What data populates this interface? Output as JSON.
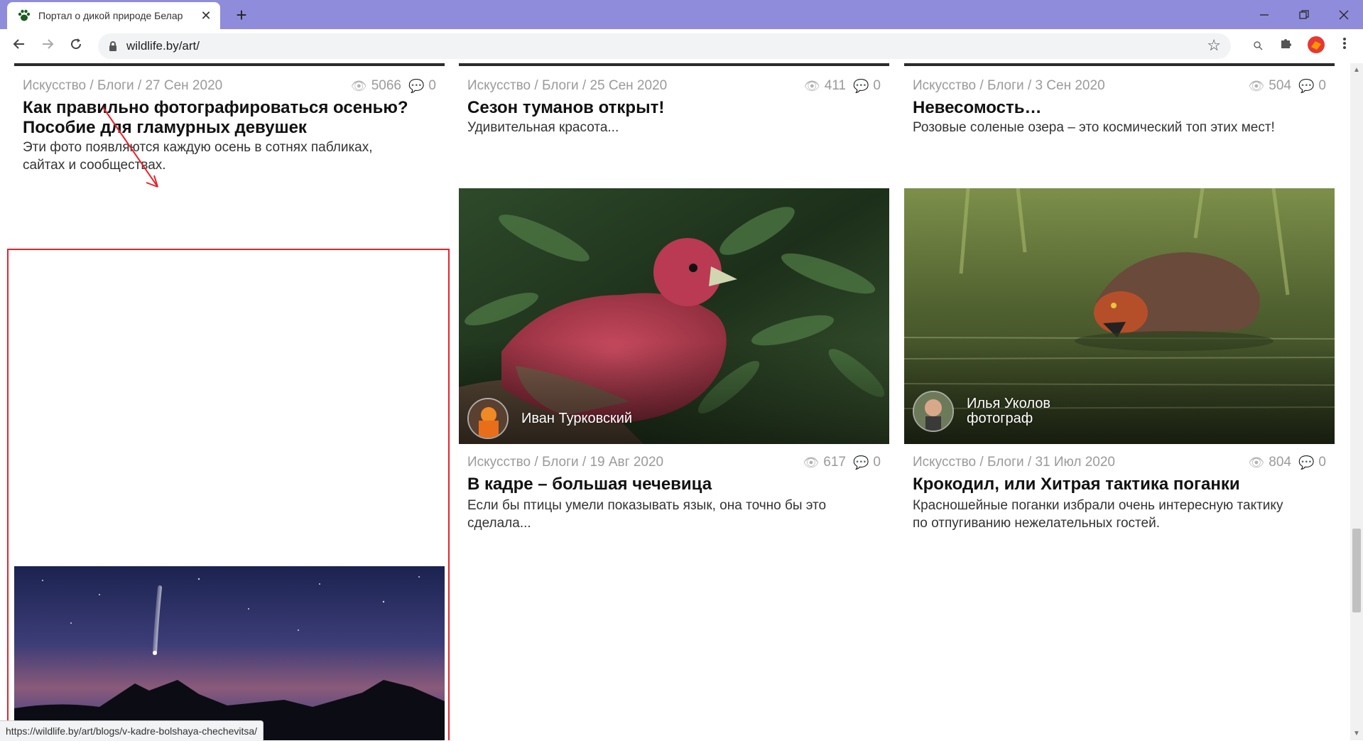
{
  "browser": {
    "tab_title": "Портал о дикой природе Белар",
    "url": "wildlife.by/art/",
    "status_url": "https://wildlife.by/art/blogs/v-kadre-bolshaya-chechevitsa/"
  },
  "icons": {
    "favicon": "paw-icon",
    "back": "arrow-left-icon",
    "forward": "arrow-right-icon",
    "reload": "reload-icon",
    "lock": "lock-icon",
    "bookmark": "star-icon",
    "extensions": "puzzle-icon",
    "menu": "kebab-icon",
    "views": "eye-icon",
    "comments": "comment-icon"
  },
  "colors": {
    "titlebar": "#8f8cdb",
    "annotation": "#e8232a",
    "meta_text": "#9a9a9a"
  },
  "cards": [
    {
      "meta": "Искусство / Блоги / 27 Сен 2020",
      "views": "5066",
      "comments": "0",
      "title_line1": "Как правильно фотографироваться осенью?",
      "title_line2": "Пособие для гламурных девушек",
      "excerpt_line1": "Эти фото появляются каждую осень в сотнях пабликах,",
      "excerpt_line2": "сайтах и сообществах."
    },
    {
      "meta": "Искусство / Блоги / 25 Сен 2020",
      "views": "411",
      "comments": "0",
      "title": "Сезон туманов открыт!",
      "excerpt": "Удивительная красота..."
    },
    {
      "meta": "Искусство / Блоги / 3 Сен 2020",
      "views": "504",
      "comments": "0",
      "title": "Невесомость…",
      "excerpt": "Розовые соленые озера – это космический топ этих мест!"
    },
    {
      "author": "Иван Турковский",
      "meta": "Искусство / Блоги / 19 Авг 2020",
      "views": "617",
      "comments": "0",
      "title": "В кадре – большая чечевица",
      "excerpt_line1": "Если бы птицы умели показывать язык, она точно бы это",
      "excerpt_line2": "сделала..."
    },
    {
      "author_line1": "Илья Уколов",
      "author_line2": "фотограф",
      "meta": "Искусство / Блоги / 31 Июл 2020",
      "views": "804",
      "comments": "0",
      "title": "Крокодил, или Хитрая тактика поганки",
      "excerpt_line1": "Красношейные поганки избрали очень интересную тактику",
      "excerpt_line2": "по отпугиванию нежелательных гостей."
    }
  ]
}
